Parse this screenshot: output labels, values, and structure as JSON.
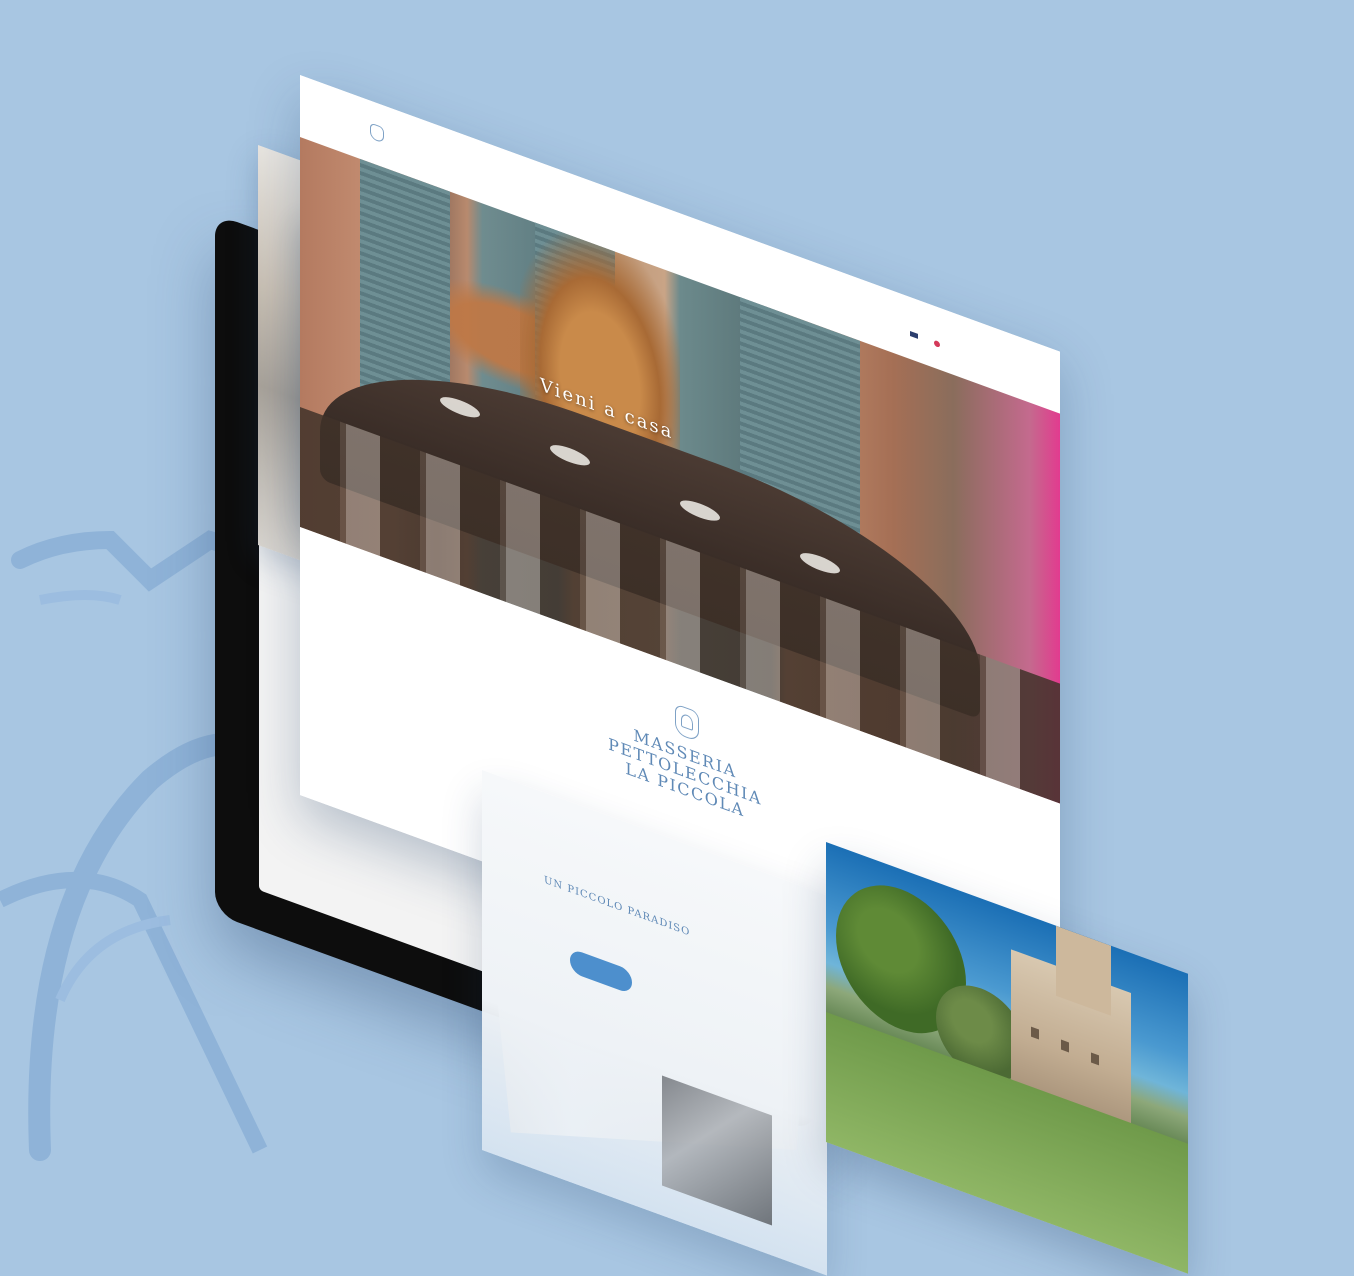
{
  "colors": {
    "background": "#a8c6e2",
    "brand_blue": "#5f89b6",
    "button_blue": "#4d8fcd",
    "accent_pink": "#e23b8f"
  },
  "site": {
    "logo_text": "",
    "nav": {
      "items": [
        "",
        "",
        "",
        "",
        "",
        ""
      ],
      "flag_icon": "flag-icon",
      "dot_icon": "pink-dot-icon"
    },
    "hero_title": "Vieni a casa",
    "intro": {
      "emblem_icon": "crest-monogram-icon",
      "title": "MASSERIA\nPETTOLECCHIA\nLA PICCOLA",
      "text": ""
    },
    "feature": {
      "title": "UN PICCOLO PARADISO",
      "text": "",
      "button_label": ""
    }
  }
}
